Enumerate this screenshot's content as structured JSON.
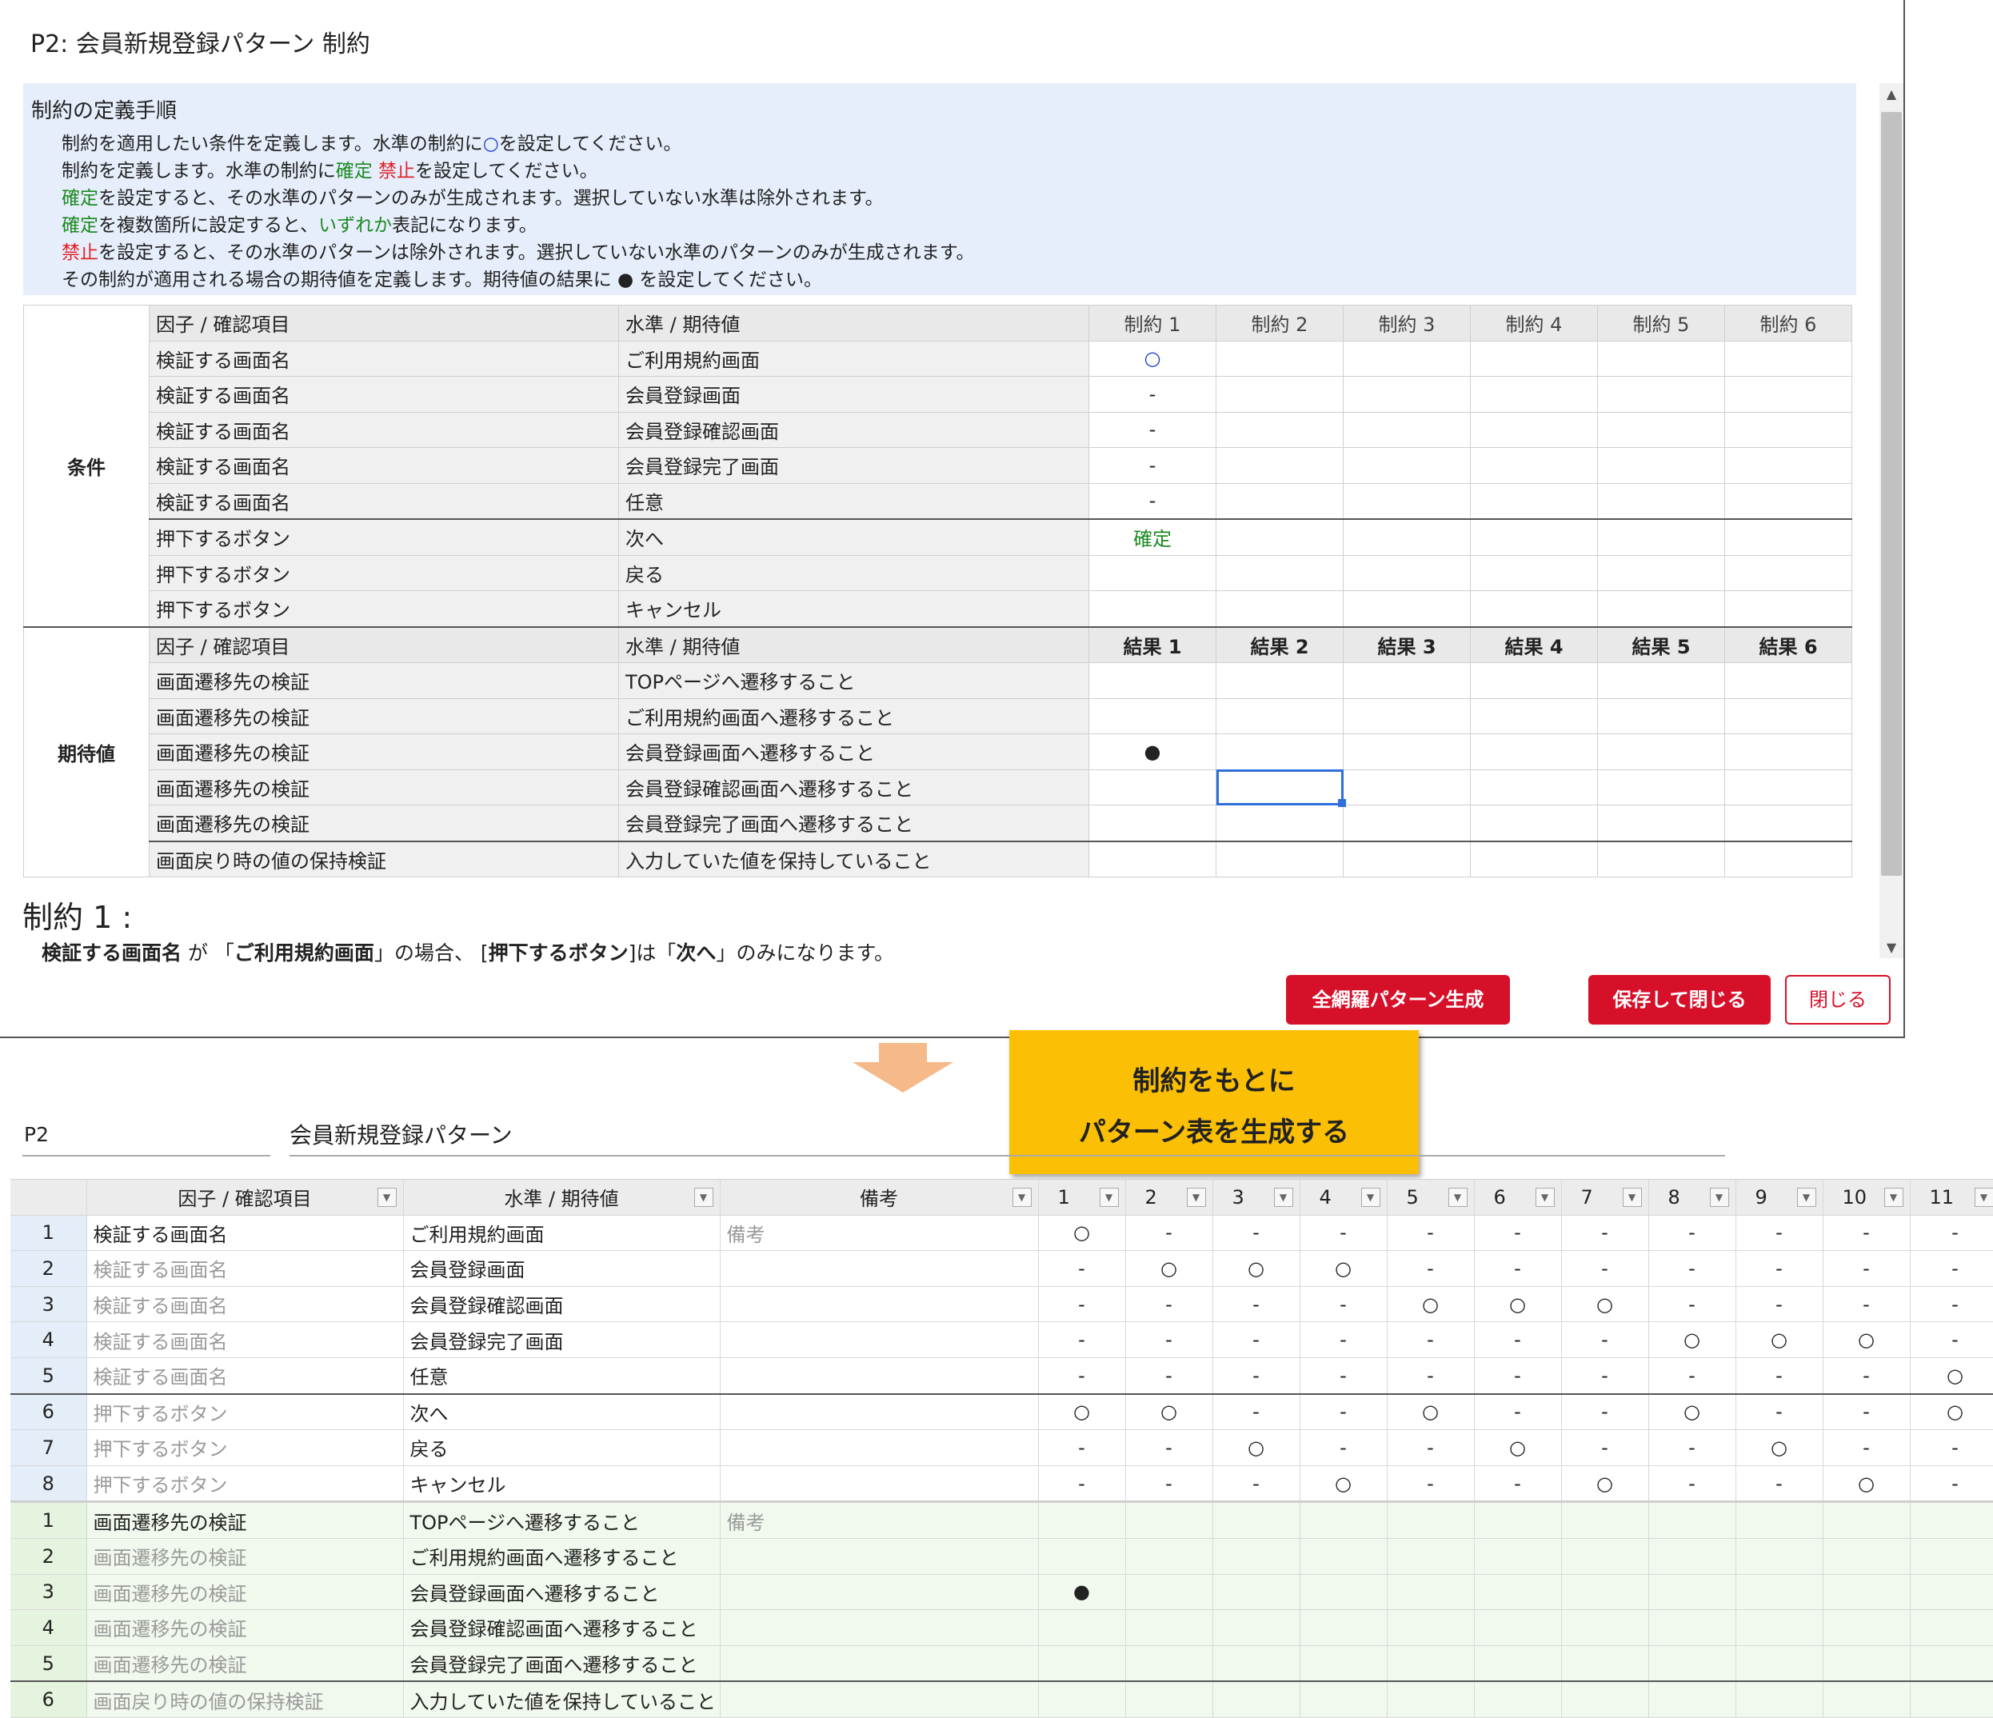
{
  "dialog": {
    "title": "P2: 会員新規登録パターン 制約",
    "procedure": {
      "title": "制約の定義手順",
      "l1_a": "制約を適用したい条件を定義します。水準の制約に",
      "l1_b": "○",
      "l1_c": "を設定してください。",
      "l2_a": "制約を定義します。水準の制約に",
      "l2_b": "確定",
      "l2_c": "禁止",
      "l2_d": "を設定してください。",
      "l3_a": "確定",
      "l3_b": "を設定すると、その水準のパターンのみが生成されます。選択していない水準は除外されます。",
      "l4_a": "確定",
      "l4_b": "を複数箇所に設定すると、",
      "l4_c": "いずれか",
      "l4_d": "表記になります。",
      "l5_a": "禁止",
      "l5_b": "を設定すると、その水準のパターンは除外されます。選択していない水準のパターンのみが生成されます。",
      "l6": "その制約が適用される場合の期待値を定義します。期待値の結果に ● を設定してください。"
    },
    "table": {
      "hdr_factor": "因子 / 確認項目",
      "hdr_level": "水準 / 期待値",
      "constraint_cols": [
        "制約 1",
        "制約 2",
        "制約 3",
        "制約 4",
        "制約 5",
        "制約 6"
      ],
      "result_cols": [
        "結果 1",
        "結果 2",
        "結果 3",
        "結果 4",
        "結果 5",
        "結果 6"
      ],
      "cond_group": "条件",
      "exp_group": "期待値",
      "cond_rows": [
        {
          "factor": "検証する画面名",
          "level": "ご利用規約画面",
          "c1": "○"
        },
        {
          "factor": "検証する画面名",
          "level": "会員登録画面",
          "c1": "-"
        },
        {
          "factor": "検証する画面名",
          "level": "会員登録確認画面",
          "c1": "-"
        },
        {
          "factor": "検証する画面名",
          "level": "会員登録完了画面",
          "c1": "-"
        },
        {
          "factor": "検証する画面名",
          "level": "任意",
          "c1": "-"
        },
        {
          "factor": "押下するボタン",
          "level": "次へ",
          "c1": "確定"
        },
        {
          "factor": "押下するボタン",
          "level": "戻る",
          "c1": ""
        },
        {
          "factor": "押下するボタン",
          "level": "キャンセル",
          "c1": ""
        }
      ],
      "exp_rows": [
        {
          "factor": "画面遷移先の検証",
          "level": "TOPページへ遷移すること",
          "c1": ""
        },
        {
          "factor": "画面遷移先の検証",
          "level": "ご利用規約画面へ遷移すること",
          "c1": ""
        },
        {
          "factor": "画面遷移先の検証",
          "level": "会員登録画面へ遷移すること",
          "c1": "●"
        },
        {
          "factor": "画面遷移先の検証",
          "level": "会員登録確認画面へ遷移すること",
          "c1": ""
        },
        {
          "factor": "画面遷移先の検証",
          "level": "会員登録完了画面へ遷移すること",
          "c1": ""
        },
        {
          "factor": "画面戻り時の値の保持検証",
          "level": "入力していた値を保持していること",
          "c1": ""
        }
      ]
    },
    "constraint_heading": "制約 1 :",
    "constraint_desc": {
      "a": "検証する画面名",
      "b": " が 「",
      "c": "ご利用規約画面",
      "d": "」の場合、 [",
      "e": "押下するボタン",
      "f": "]は「",
      "g": "次へ",
      "h": "」のみになります。"
    },
    "buttons": {
      "generate": "全網羅パターン生成",
      "save_close": "保存して閉じる",
      "close": "閉じる"
    }
  },
  "callout": {
    "line1": "制約をもとに",
    "line2": "パターン表を生成する"
  },
  "colors": {
    "accent_red": "#d7102a",
    "callout_yellow": "#fbbf05",
    "arrow_peach": "#f5b98a",
    "confirm_green": "#1d8a22",
    "forbid_red": "#e0242a"
  },
  "grid": {
    "pattern_id": "P2",
    "pattern_name": "会員新規登録パターン",
    "hdr_factor": "因子 / 確認項目",
    "hdr_level": "水準 / 期待値",
    "hdr_note": "備考",
    "filter_icon": "▼",
    "pattern_cols": [
      "1",
      "2",
      "3",
      "4",
      "5",
      "6",
      "7",
      "8",
      "9",
      "10",
      "11"
    ],
    "factor_rows": [
      {
        "idx": "1",
        "factor": "検証する画面名",
        "level": "ご利用規約画面",
        "note": "備考",
        "v": [
          "○",
          "-",
          "-",
          "-",
          "-",
          "-",
          "-",
          "-",
          "-",
          "-",
          "-"
        ]
      },
      {
        "idx": "2",
        "factor": "検証する画面名",
        "level": "会員登録画面",
        "note": "",
        "v": [
          "-",
          "○",
          "○",
          "○",
          "-",
          "-",
          "-",
          "-",
          "-",
          "-",
          "-"
        ]
      },
      {
        "idx": "3",
        "factor": "検証する画面名",
        "level": "会員登録確認画面",
        "note": "",
        "v": [
          "-",
          "-",
          "-",
          "-",
          "○",
          "○",
          "○",
          "-",
          "-",
          "-",
          "-"
        ]
      },
      {
        "idx": "4",
        "factor": "検証する画面名",
        "level": "会員登録完了画面",
        "note": "",
        "v": [
          "-",
          "-",
          "-",
          "-",
          "-",
          "-",
          "-",
          "○",
          "○",
          "○",
          "-"
        ]
      },
      {
        "idx": "5",
        "factor": "検証する画面名",
        "level": "任意",
        "note": "",
        "v": [
          "-",
          "-",
          "-",
          "-",
          "-",
          "-",
          "-",
          "-",
          "-",
          "-",
          "○"
        ]
      },
      {
        "idx": "6",
        "factor": "押下するボタン",
        "level": "次へ",
        "note": "",
        "v": [
          "○",
          "○",
          "-",
          "-",
          "○",
          "-",
          "-",
          "○",
          "-",
          "-",
          "○"
        ]
      },
      {
        "idx": "7",
        "factor": "押下するボタン",
        "level": "戻る",
        "note": "",
        "v": [
          "-",
          "-",
          "○",
          "-",
          "-",
          "○",
          "-",
          "-",
          "○",
          "-",
          "-"
        ]
      },
      {
        "idx": "8",
        "factor": "押下するボタン",
        "level": "キャンセル",
        "note": "",
        "v": [
          "-",
          "-",
          "-",
          "○",
          "-",
          "-",
          "○",
          "-",
          "-",
          "○",
          "-"
        ]
      }
    ],
    "exp_rows": [
      {
        "idx": "1",
        "factor": "画面遷移先の検証",
        "level": "TOPページへ遷移すること",
        "note": "備考",
        "v": [
          "",
          "",
          "",
          "",
          "",
          "",
          "",
          "",
          "",
          "",
          ""
        ]
      },
      {
        "idx": "2",
        "factor": "画面遷移先の検証",
        "level": "ご利用規約画面へ遷移すること",
        "note": "",
        "v": [
          "",
          "",
          "",
          "",
          "",
          "",
          "",
          "",
          "",
          "",
          ""
        ]
      },
      {
        "idx": "3",
        "factor": "画面遷移先の検証",
        "level": "会員登録画面へ遷移すること",
        "note": "",
        "v": [
          "●",
          "",
          "",
          "",
          "",
          "",
          "",
          "",
          "",
          "",
          ""
        ]
      },
      {
        "idx": "4",
        "factor": "画面遷移先の検証",
        "level": "会員登録確認画面へ遷移すること",
        "note": "",
        "v": [
          "",
          "",
          "",
          "",
          "",
          "",
          "",
          "",
          "",
          "",
          ""
        ]
      },
      {
        "idx": "5",
        "factor": "画面遷移先の検証",
        "level": "会員登録完了画面へ遷移すること",
        "note": "",
        "v": [
          "",
          "",
          "",
          "",
          "",
          "",
          "",
          "",
          "",
          "",
          ""
        ]
      },
      {
        "idx": "6",
        "factor": "画面戻り時の値の保持検証",
        "level": "入力していた値を保持していること",
        "note": "",
        "v": [
          "",
          "",
          "",
          "",
          "",
          "",
          "",
          "",
          "",
          "",
          ""
        ]
      }
    ]
  }
}
